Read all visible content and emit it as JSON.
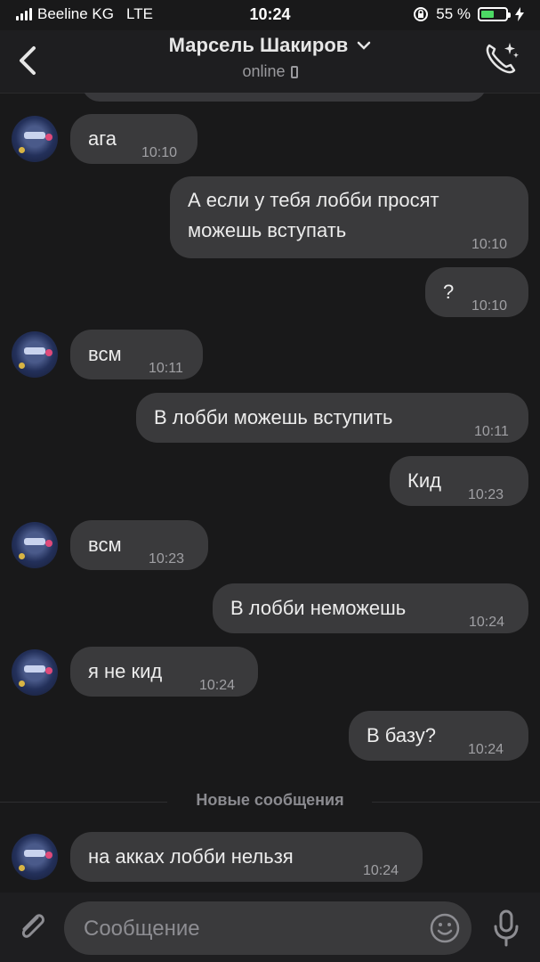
{
  "status": {
    "carrier": "Beeline KG",
    "network": "LTE",
    "time": "10:24",
    "battery_text": "55 %",
    "battery_level": 0.55
  },
  "header": {
    "contact_name": "Марсель Шакиров",
    "status": "online"
  },
  "messages": [
    {
      "dir": "in",
      "text": "ага",
      "time": "10:10"
    },
    {
      "dir": "out",
      "lines": [
        "А если у тебя лобби просят",
        "можешь вступать"
      ],
      "time": "10:10"
    },
    {
      "dir": "out",
      "text": "?",
      "time": "10:10"
    },
    {
      "dir": "in",
      "text": "всм",
      "time": "10:11"
    },
    {
      "dir": "out",
      "text": "В лобби можешь вступить",
      "time": "10:11"
    },
    {
      "dir": "out",
      "text": "Кид",
      "time": "10:23"
    },
    {
      "dir": "in",
      "text": "всм",
      "time": "10:23"
    },
    {
      "dir": "out",
      "text": "В лобби неможешь",
      "time": "10:24"
    },
    {
      "dir": "in",
      "text": "я не кид",
      "time": "10:24"
    },
    {
      "dir": "out",
      "text": "В базу?",
      "time": "10:24"
    },
    {
      "dir": "in",
      "text": "на акках лобби нельзя",
      "time": "10:24"
    }
  ],
  "new_messages_label": "Новые сообщения",
  "composer": {
    "placeholder": "Сообщение"
  },
  "colors": {
    "background": "#19191a",
    "bubble": "#3a3a3c",
    "battery_fill": "#4cd964"
  }
}
